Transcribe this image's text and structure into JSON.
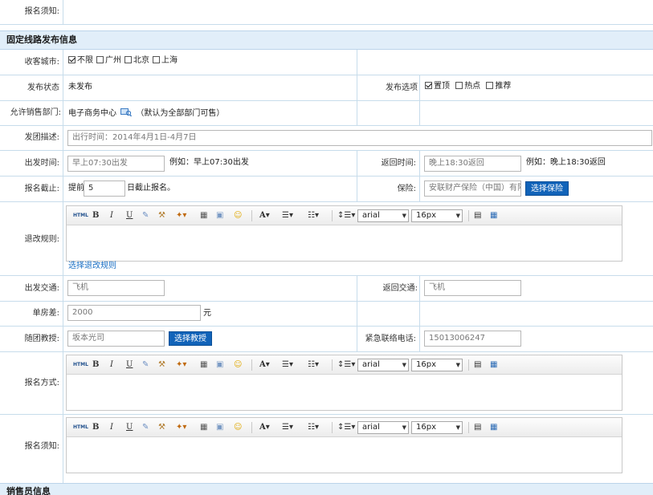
{
  "top_row": {
    "label": "报名须知:"
  },
  "section_fixed": {
    "title": "固定线路发布信息"
  },
  "section_sales": {
    "title": "销售员信息"
  },
  "city": {
    "label": "收客城市:",
    "options": [
      {
        "label": "不限",
        "checked": true
      },
      {
        "label": "广州",
        "checked": false
      },
      {
        "label": "北京",
        "checked": false
      },
      {
        "label": "上海",
        "checked": false
      }
    ]
  },
  "publish_status": {
    "label": "发布状态",
    "value": "未发布"
  },
  "publish_options": {
    "label": "发布选项",
    "options": [
      {
        "label": "置顶",
        "checked": true
      },
      {
        "label": "热点",
        "checked": false
      },
      {
        "label": "推荐",
        "checked": false
      }
    ]
  },
  "allowed_dept": {
    "label": "允许销售部门:",
    "value": "电子商务中心",
    "note": "（默认为全部部门可售）"
  },
  "group_desc": {
    "label": "发团描述:",
    "value": "出行时间：2014年4月1日-4月7日"
  },
  "departure_time": {
    "label": "出发时间:",
    "value": "早上07:30出发",
    "example": "例如：早上07:30出发"
  },
  "return_time": {
    "label": "返回时间:",
    "value": "晚上18:30返回",
    "example": "例如：晚上18:30返回"
  },
  "deadline": {
    "label": "报名截止:",
    "prefix": "提前",
    "value": "5",
    "suffix": "日截止报名。"
  },
  "insurance": {
    "label": "保险:",
    "value": "安联财产保险（中国）有限",
    "button": "选择保险"
  },
  "refund_rules": {
    "label": "退改规则:",
    "link": "选择退改规则"
  },
  "editor": {
    "html_label": "HTML",
    "bold": "B",
    "italic": "I",
    "underline": "U",
    "font_icon": "A",
    "font_name": "arial",
    "font_size": "16px"
  },
  "departure_transport": {
    "label": "出发交通:",
    "value": "飞机"
  },
  "return_transport": {
    "label": "返回交通:",
    "value": "飞机"
  },
  "single_room": {
    "label": "单房差:",
    "value": "2000",
    "unit": "元"
  },
  "guide": {
    "label": "随团教授:",
    "value": "坂本光司",
    "button": "选择教授"
  },
  "emergency_phone": {
    "label": "紧急联络电话:",
    "value": "15013006247"
  },
  "signup_method": {
    "label": "报名方式:"
  },
  "signup_notice": {
    "label": "报名须知:"
  },
  "colors": {
    "section_bg": "#e1eef9",
    "grid": "#c7dceb",
    "button": "#1163b9",
    "link": "#1a6fc4"
  }
}
